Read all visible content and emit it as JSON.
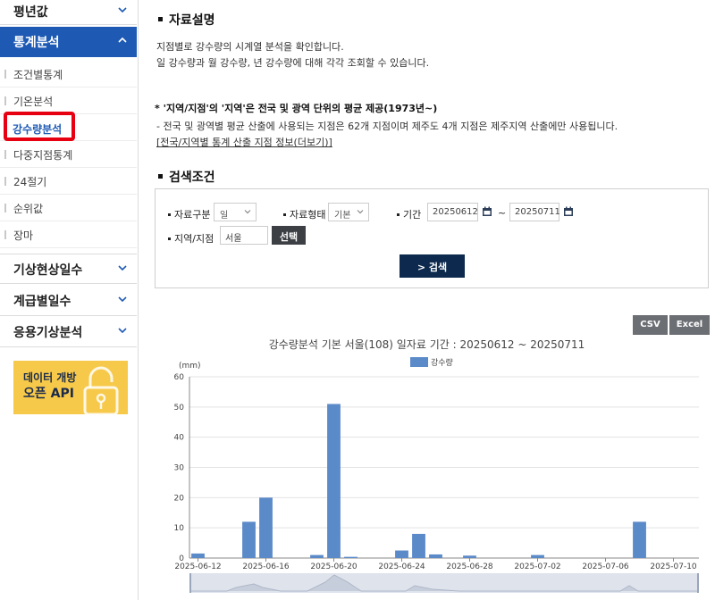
{
  "sidebar": {
    "top_section": "평년값",
    "stats_section": "통계분석",
    "sub_items": [
      "조건별통계",
      "기온분석",
      "강수량분석",
      "다중지점통계",
      "24절기",
      "순위값",
      "장마"
    ],
    "active_sub_index": 2,
    "bottom_sections": [
      "기상현상일수",
      "계급별일수",
      "응용기상분석"
    ],
    "api_banner": {
      "line1": "데이터 개방",
      "line2": "오픈 API"
    }
  },
  "description": {
    "title": "자료설명",
    "line1": "지점별로 강수량의 시계열 분석을 확인합니다.",
    "line2": "일 강수량과 월 강수량, 년 강수량에 대해 각각 조회할 수 있습니다.",
    "note_bold": "* '지역/지점'의 '지역'은 전국 및 광역 단위의 평균 제공(1973년~)",
    "note_line": "- 전국 및 광역별 평균 산출에 사용되는 지점은 62개 지점이며 제주도 4개 지점은 제주지역 산출에만 사용됩니다.",
    "note_link": "[전국/지역별 통계 산출 지점 정보(더보기)]"
  },
  "search": {
    "title": "검색조건",
    "data_type_label": "자료구분",
    "data_type_value": "일",
    "data_form_label": "자료형태",
    "data_form_value": "기본",
    "period_label": "기간",
    "start_date": "20250612",
    "tilde": "~",
    "end_date": "20250711",
    "station_label": "지역/지점",
    "station_value": "서울",
    "select_button": "선택",
    "search_button": "> 검색"
  },
  "export": {
    "csv": "CSV",
    "excel": "Excel"
  },
  "colors": {
    "bar": "#5b8ac9",
    "primary": "#1e5ab4",
    "highlight": "#e60012",
    "navy": "#0d2a4e"
  },
  "chart_data": {
    "type": "bar",
    "title": "강수량분석 기본 서울(108) 일자료 기간 : 20250612 ~ 20250711",
    "ylabel": "(mm)",
    "ylim": [
      0,
      60
    ],
    "yticks": [
      0,
      10,
      20,
      30,
      40,
      50,
      60
    ],
    "xtick_labels": [
      "2025-06-12",
      "2025-06-16",
      "2025-06-20",
      "2025-06-24",
      "2025-06-28",
      "2025-07-02",
      "2025-07-06",
      "2025-07-10"
    ],
    "categories": [
      "2025-06-12",
      "2025-06-13",
      "2025-06-14",
      "2025-06-15",
      "2025-06-16",
      "2025-06-17",
      "2025-06-18",
      "2025-06-19",
      "2025-06-20",
      "2025-06-21",
      "2025-06-22",
      "2025-06-23",
      "2025-06-24",
      "2025-06-25",
      "2025-06-26",
      "2025-06-27",
      "2025-06-28",
      "2025-06-29",
      "2025-06-30",
      "2025-07-01",
      "2025-07-02",
      "2025-07-03",
      "2025-07-04",
      "2025-07-05",
      "2025-07-06",
      "2025-07-07",
      "2025-07-08",
      "2025-07-09",
      "2025-07-10",
      "2025-07-11"
    ],
    "series": [
      {
        "name": "강수량",
        "values": [
          1.5,
          0,
          0,
          12,
          20,
          0,
          0,
          1,
          51,
          0.4,
          0,
          0,
          2.5,
          8,
          1.2,
          0,
          0.8,
          0,
          0,
          0,
          1,
          0,
          0,
          0,
          0,
          0,
          12,
          0,
          0,
          0
        ]
      }
    ],
    "legend": "top-center",
    "grid": true
  }
}
